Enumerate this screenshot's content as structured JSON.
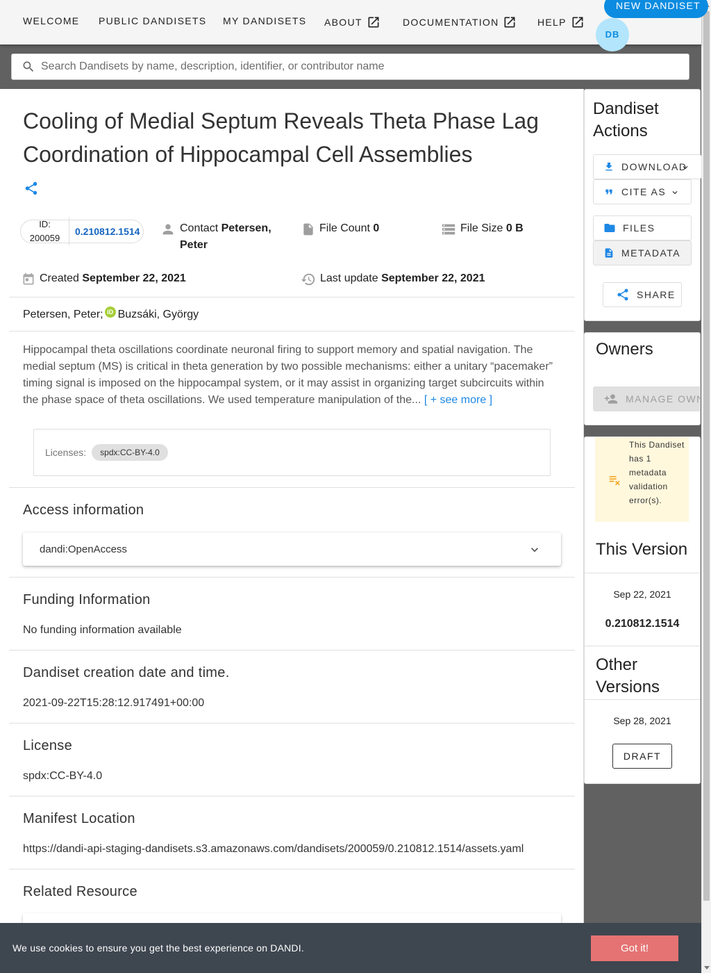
{
  "nav": {
    "items": [
      {
        "label": "Welcome",
        "external": false
      },
      {
        "label": "Public Dandisets",
        "external": false
      },
      {
        "label": "My Dandisets",
        "external": false
      },
      {
        "label": "About",
        "external": true
      },
      {
        "label": "Documentation",
        "external": true
      },
      {
        "label": "Help",
        "external": true
      }
    ],
    "new_dandiset": "New Dandiset",
    "avatar_initials": "DB"
  },
  "search": {
    "placeholder": "Search Dandisets by name, description, identifier, or contributor name"
  },
  "dandiset": {
    "title": "Cooling of Medial Septum Reveals Theta Phase Lag Coordination of Hippocampal Cell Assemblies",
    "id_label": "ID:",
    "id": "200059",
    "version": "0.210812.1514",
    "contact_label": "Contact",
    "contact_name": "Petersen, Peter",
    "file_count_label": "File Count",
    "file_count": "0",
    "file_size_label": "File Size",
    "file_size": "0 B",
    "created_label": "Created",
    "created": "September 22, 2021",
    "updated_label": "Last update",
    "updated": "September 22, 2021",
    "contributors": [
      "Petersen, Peter;",
      "Buzsáki, György"
    ],
    "description": "Hippocampal theta oscillations coordinate neuronal firing to support memory and spatial navigation. The medial septum (MS) is critical in theta generation by two possible mechanisms: either a unitary “pacemaker” timing signal is imposed on the hippocampal system, or it may assist in organizing target subcircuits within the phase space of theta oscillations. We used temperature manipulation of the...",
    "see_more": "[ + see more ]",
    "licenses_label": "Licenses:",
    "license_chip": "spdx:CC-BY-4.0"
  },
  "sections": {
    "access": {
      "heading": "Access information",
      "value": "dandi:OpenAccess"
    },
    "funding": {
      "heading": "Funding Information",
      "value": "No funding information available"
    },
    "creation": {
      "heading": "Dandiset creation date and time.",
      "value": "2021-09-22T15:28:12.917491+00:00"
    },
    "license": {
      "heading": "License",
      "value": "spdx:CC-BY-4.0"
    },
    "manifest": {
      "heading": "Manifest Location",
      "value": "https://dandi-api-staging-dandisets.s3.amazonaws.com/dandisets/200059/0.210812.1514/assets.yaml"
    },
    "related": {
      "heading": "Related Resource"
    }
  },
  "sidebar": {
    "actions_heading": "Dandiset Actions",
    "download": "Download",
    "cite": "Cite As",
    "files": "Files",
    "metadata": "Metadata",
    "share": "Share",
    "owners_heading": "Owners",
    "manage_owners": "Manage Own",
    "validation_warning": "This Dandiset has 1 metadata validation error(s).",
    "this_version_heading": "This Version",
    "this_version_date": "Sep 22, 2021",
    "this_version_id": "0.210812.1514",
    "other_versions_heading": "Other Versions",
    "other_version_date": "Sep 28, 2021",
    "other_version_label": "Draft"
  },
  "cookie": {
    "text": "We use cookies to ensure you get the best experience on DANDI.",
    "button": "Got it!"
  },
  "colors": {
    "primary": "#0b8ce0",
    "link": "#1e88e5",
    "warning_bg": "#fff8dd",
    "warning_icon": "#f5a623",
    "cookie_bar": "#3e4650",
    "cookie_button": "#e57373"
  }
}
